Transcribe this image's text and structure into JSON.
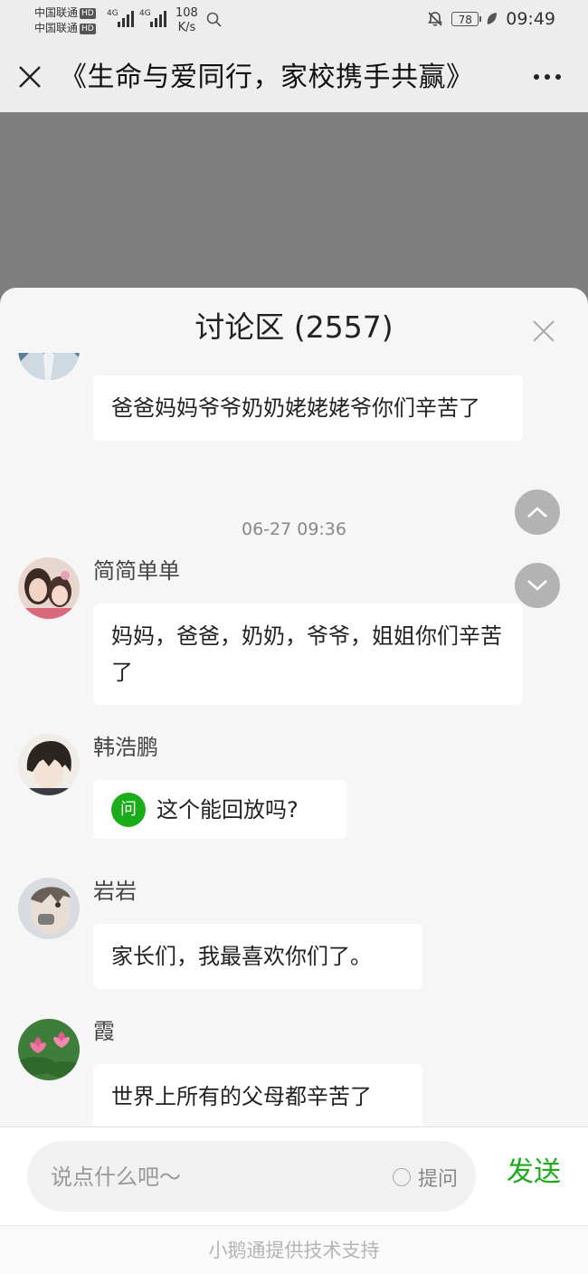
{
  "status_bar": {
    "carrier1": "中国联通",
    "carrier2": "中国联通",
    "hd": "HD",
    "net": "4G",
    "speed_value": "108",
    "speed_unit": "K/s",
    "battery": "78",
    "time": "09:49",
    "icons": [
      "search-icon",
      "bell-off-icon",
      "battery-icon",
      "leaf-icon"
    ]
  },
  "header": {
    "title": "《生命与爱同行，家校携手共赢》"
  },
  "discussion": {
    "title": "讨论区 (2557)",
    "messages": [
      {
        "name": "",
        "text": "爸爸妈妈爷爷奶奶姥姥姥爷你们辛苦了"
      },
      {
        "timestamp": "06-27 09:36"
      },
      {
        "name": "简简单单",
        "text": "妈妈，爸爸，奶奶，爷爷，姐姐你们辛苦了"
      },
      {
        "name": "韩浩鹏",
        "question_badge": "问",
        "text": "这个能回放吗?"
      },
      {
        "name": "岩岩",
        "text": "家长们，我最喜欢你们了。"
      },
      {
        "name": "霞",
        "text": "世界上所有的父母都辛苦了"
      }
    ]
  },
  "input": {
    "placeholder": "说点什么吧～",
    "ask_label": "提问",
    "send_label": "发送"
  },
  "footer": {
    "text": "小鹅通提供技术支持"
  },
  "colors": {
    "accent_green": "#1aad19",
    "video_gray": "#7f7f7f"
  }
}
